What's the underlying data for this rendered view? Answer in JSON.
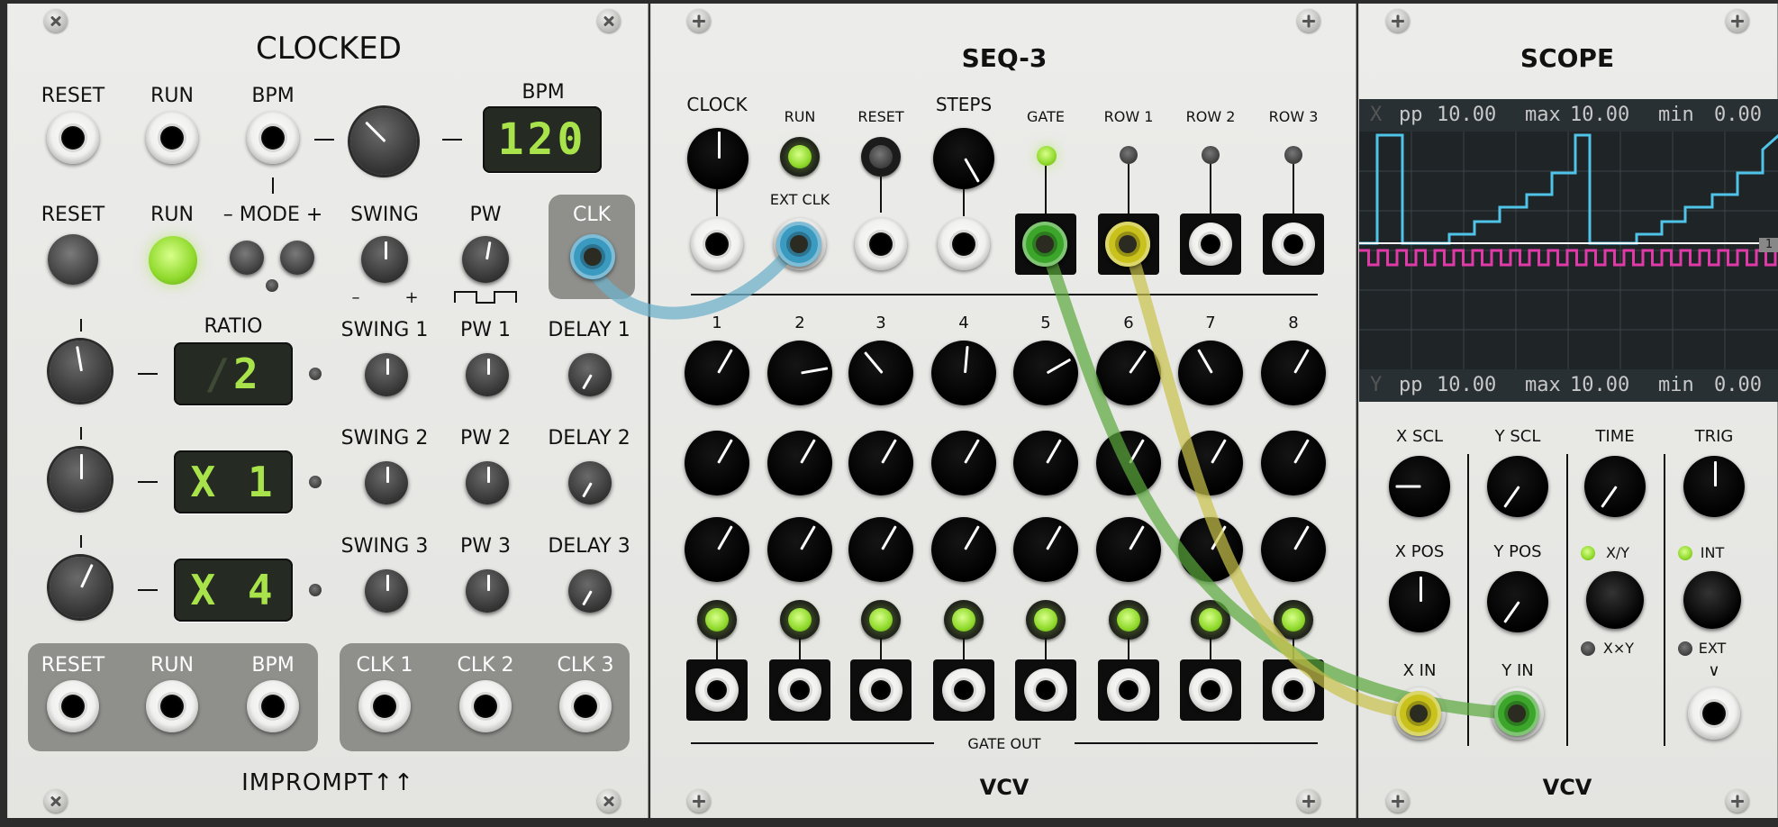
{
  "modules": {
    "clocked": {
      "title": "CLOCKED",
      "brand": "IMPROMPT↑↑",
      "top_labels": {
        "reset": "RESET",
        "run": "RUN",
        "bpm": "BPM",
        "bpm_display_label": "BPM"
      },
      "bpm_value": "120",
      "row2_labels": {
        "reset": "RESET",
        "run": "RUN",
        "mode": "– MODE +",
        "swing": "SWING",
        "pw": "PW",
        "clk": "CLK"
      },
      "swing_minus": "–",
      "swing_plus": "+",
      "ratio_label": "RATIO",
      "ratios": [
        {
          "ghost": "/",
          "value": "2"
        },
        {
          "ghost": "",
          "value": "X 1"
        },
        {
          "ghost": "",
          "value": "X 4"
        }
      ],
      "sub_labels": [
        {
          "swing": "SWING 1",
          "pw": "PW 1",
          "delay": "DELAY 1"
        },
        {
          "swing": "SWING 2",
          "pw": "PW 2",
          "delay": "DELAY 2"
        },
        {
          "swing": "SWING 3",
          "pw": "PW 3",
          "delay": "DELAY 3"
        }
      ],
      "bottom_inputs": [
        "RESET",
        "RUN",
        "BPM"
      ],
      "bottom_outputs": [
        "CLK 1",
        "CLK 2",
        "CLK 3"
      ]
    },
    "seq3": {
      "title": "SEQ-3",
      "brand": "VCV",
      "top_labels": {
        "clock": "CLOCK",
        "run": "RUN",
        "ext_clk": "EXT CLK",
        "reset": "RESET",
        "steps": "STEPS",
        "gate": "GATE",
        "row1": "ROW 1",
        "row2": "ROW 2",
        "row3": "ROW 3"
      },
      "step_numbers": [
        "1",
        "2",
        "3",
        "4",
        "5",
        "6",
        "7",
        "8"
      ],
      "gate_out_label": "GATE OUT"
    },
    "scope": {
      "title": "SCOPE",
      "brand": "VCV",
      "x_header": {
        "axis": "X",
        "pp_label": "pp",
        "pp": "10.00",
        "max_label": "max",
        "max": "10.00",
        "min_label": "min",
        "min": "0.00"
      },
      "y_header": {
        "axis": "Y",
        "pp_label": "pp",
        "pp": "10.00",
        "max_label": "max",
        "max": "10.00",
        "min_label": "min",
        "min": "0.00"
      },
      "marker": "1",
      "controls": {
        "x_scl": "X SCL",
        "y_scl": "Y SCL",
        "time": "TIME",
        "trig": "TRIG",
        "x_pos": "X POS",
        "y_pos": "Y POS",
        "xy": "X/Y",
        "xxy": "X×Y",
        "int": "INT",
        "ext": "EXT",
        "ext_arrow": "∨",
        "x_in": "X IN",
        "y_in": "Y IN"
      },
      "colors": {
        "trace_x": "#4fc3e8",
        "trace_y": "#e03aa8",
        "grid": "#3a4448"
      }
    }
  },
  "cable_colors": {
    "blue": "#6fb2c9",
    "green": "#5aa83c",
    "yellow": "#c9c24a"
  }
}
